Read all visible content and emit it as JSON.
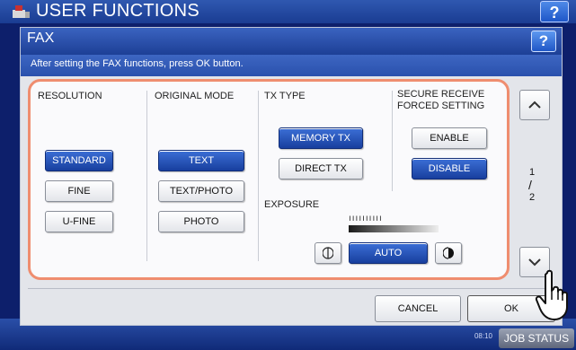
{
  "background_app": {
    "title": "USER FUNCTIONS",
    "help_label": "?",
    "date_time": "08:10",
    "job_status_label": "JOB STATUS"
  },
  "dialog": {
    "title": "FAX",
    "help_label": "?",
    "message": "After setting the FAX functions, press OK button."
  },
  "resolution": {
    "label": "RESOLUTION",
    "options": [
      "STANDARD",
      "FINE",
      "U-FINE"
    ],
    "selected": "STANDARD"
  },
  "original_mode": {
    "label": "ORIGINAL MODE",
    "options": [
      "TEXT",
      "TEXT/PHOTO",
      "PHOTO"
    ],
    "selected": "TEXT"
  },
  "tx_type": {
    "label": "TX TYPE",
    "options": [
      "MEMORY TX",
      "DIRECT TX"
    ],
    "selected": "MEMORY TX"
  },
  "exposure": {
    "label": "EXPOSURE",
    "auto_label": "AUTO",
    "auto_selected": true,
    "scale": "ıııııııııı"
  },
  "secure_receive": {
    "label_line1": "SECURE RECEIVE",
    "label_line2": "FORCED SETTING",
    "options": [
      "ENABLE",
      "DISABLE"
    ],
    "selected": "DISABLE"
  },
  "pagination": {
    "current": "1",
    "separator": "/",
    "total": "2"
  },
  "footer": {
    "cancel_label": "CANCEL",
    "ok_label": "OK"
  },
  "colors": {
    "selected_button": "#1d4aa8",
    "panel_border": "#ef8d6f",
    "header_blue": "#2a51ad"
  }
}
